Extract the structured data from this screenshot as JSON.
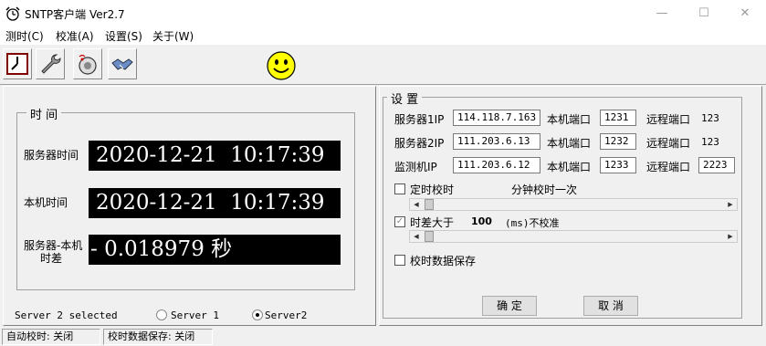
{
  "window": {
    "title": "SNTP客户端  Ver2.7"
  },
  "titlebar": {
    "minimize": "—",
    "maximize": "☐",
    "close": "✕"
  },
  "menu": [
    "测时(C)",
    "校准(A)",
    "设置(S)",
    "关于(W)"
  ],
  "toolbar": {
    "icons": [
      "clock-icon",
      "wrench-icon",
      "antenna-icon",
      "handshake-icon",
      "smiley-icon"
    ]
  },
  "time_group": {
    "title": "时  间",
    "server_time_label": "服务器时间",
    "server_time": "2020-12-21  10:17:39",
    "local_time_label": "本机时间",
    "local_time": "2020-12-21  10:17:39",
    "diff_label_1": "服务器-本机",
    "diff_label_2": "时差",
    "diff_value": "- 0.018979 秒"
  },
  "server_select": {
    "status": "Server 2 selected",
    "option1": "Server 1",
    "option2": "Server2",
    "selected": "Server2"
  },
  "settings": {
    "title": "设 置",
    "rows": [
      {
        "label": "服务器1IP",
        "ip": "114.118.7.163",
        "local_port_label": "本机端口",
        "local_port": "1231",
        "remote_port_label": "远程端口",
        "remote_port": "123"
      },
      {
        "label": "服务器2IP",
        "ip": "111.203.6.13",
        "local_port_label": "本机端口",
        "local_port": "1232",
        "remote_port_label": "远程端口",
        "remote_port": "123"
      },
      {
        "label": "监测机IP",
        "ip": "111.203.6.12",
        "local_port_label": "本机端口",
        "local_port": "1233",
        "remote_port_label": "远程端口",
        "remote_port": "2223"
      }
    ],
    "timed_sync_label": "定时校时",
    "timed_sync_suffix": "分钟校时一次",
    "timed_sync_checked": false,
    "diff_label": "时差大于",
    "diff_value": "100",
    "diff_suffix": "(ms)不校准",
    "diff_checked": true,
    "save_label": "校时数据保存",
    "save_checked": false,
    "ok_label": "确  定",
    "cancel_label": "取  消"
  },
  "status": {
    "auto_sync": "自动校时: 关闭",
    "data_save": "校时数据保存: 关闭"
  }
}
